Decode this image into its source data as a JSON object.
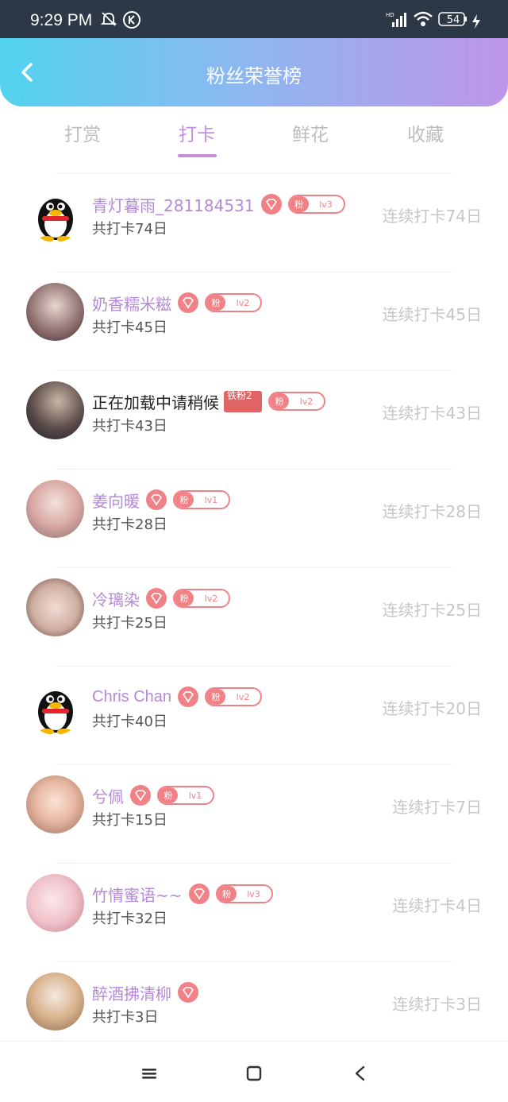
{
  "status_bar": {
    "time": "9:29 PM",
    "battery": "54"
  },
  "header": {
    "title": "粉丝荣誉榜"
  },
  "tabs": [
    {
      "label": "打赏"
    },
    {
      "label": "打卡"
    },
    {
      "label": "鲜花"
    },
    {
      "label": "收藏"
    }
  ],
  "active_tab": "打卡",
  "rows": [
    {
      "name": "青灯暮雨_281184531",
      "level": "lv3",
      "fan_badge": "粉",
      "total": "共打卡74日",
      "streak": "连续打卡74日"
    },
    {
      "name": "奶香糯米糍",
      "level": "lv2",
      "fan_badge": "粉",
      "total": "共打卡45日",
      "streak": "连续打卡45日"
    },
    {
      "name": "正在加载中请稍候",
      "badge": "铁粉2",
      "level": "lv2",
      "fan_badge": "粉",
      "total": "共打卡43日",
      "streak": "连续打卡43日"
    },
    {
      "name": "姜向暖",
      "level": "lv1",
      "fan_badge": "粉",
      "total": "共打卡28日",
      "streak": "连续打卡28日"
    },
    {
      "name": "冷璃染",
      "level": "lv2",
      "fan_badge": "粉",
      "total": "共打卡25日",
      "streak": "连续打卡25日"
    },
    {
      "name": "Chris Chan",
      "level": "lv2",
      "fan_badge": "粉",
      "total": "共打卡40日",
      "streak": "连续打卡20日"
    },
    {
      "name": "兮佩",
      "level": "lv1",
      "fan_badge": "粉",
      "total": "共打卡15日",
      "streak": "连续打卡7日"
    },
    {
      "name": "竹情蜜语~~",
      "level": "lv3",
      "fan_badge": "粉",
      "total": "共打卡32日",
      "streak": "连续打卡4日"
    },
    {
      "name": "醉酒拂清柳",
      "total": "共打卡3日",
      "streak": "连续打卡3日"
    }
  ],
  "colors": {
    "accent": "#c48de0",
    "badge": "#f08287",
    "header_start": "#52d3ef",
    "header_end": "#be95e9"
  },
  "icons": {
    "back": "back-arrow-icon",
    "nav": [
      "menu-icon",
      "home-square-icon",
      "back-triangle-icon"
    ]
  }
}
